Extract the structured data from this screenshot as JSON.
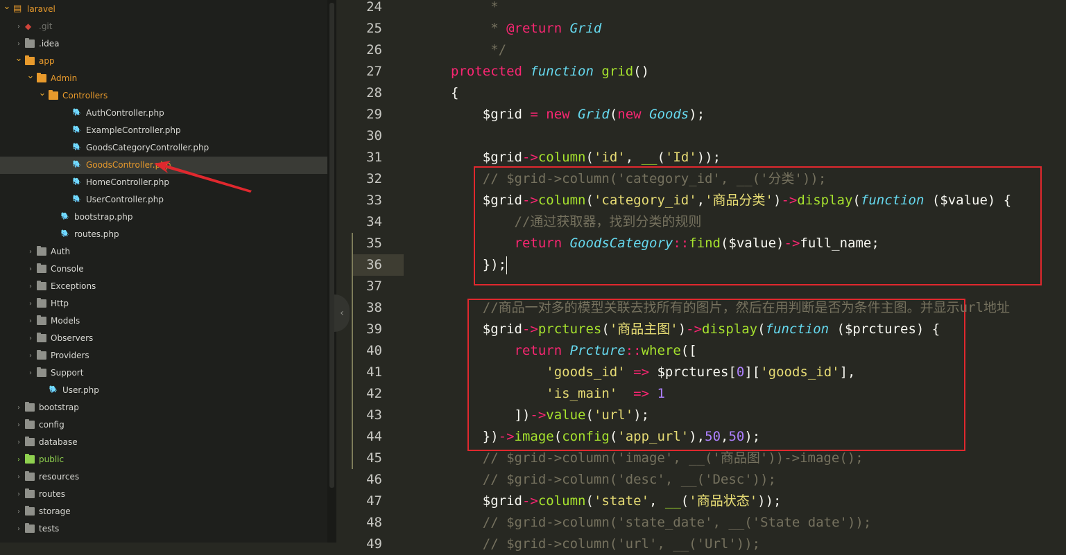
{
  "sidebar": {
    "items": [
      {
        "label": "laravel",
        "kind": "root",
        "arrow": "open",
        "style": "orange"
      },
      {
        "label": ".git",
        "kind": "git",
        "arrow": "closed",
        "style": "dim"
      },
      {
        "label": ".idea",
        "kind": "folder",
        "arrow": "closed",
        "style": ""
      },
      {
        "label": "app",
        "kind": "folder-orange",
        "arrow": "open",
        "style": "orange"
      },
      {
        "label": "Admin",
        "kind": "folder-orange",
        "arrow": "open",
        "style": "orange"
      },
      {
        "label": "Controllers",
        "kind": "folder-orange",
        "arrow": "open",
        "style": "orange"
      },
      {
        "label": "AuthController.php",
        "kind": "php",
        "arrow": "",
        "style": ""
      },
      {
        "label": "ExampleController.php",
        "kind": "php",
        "arrow": "",
        "style": ""
      },
      {
        "label": "GoodsCategoryController.php",
        "kind": "php",
        "arrow": "",
        "style": ""
      },
      {
        "label": "GoodsController.php",
        "kind": "php",
        "arrow": "",
        "style": "orange",
        "selected": true
      },
      {
        "label": "HomeController.php",
        "kind": "php",
        "arrow": "",
        "style": ""
      },
      {
        "label": "UserController.php",
        "kind": "php",
        "arrow": "",
        "style": ""
      },
      {
        "label": "bootstrap.php",
        "kind": "php",
        "arrow": "",
        "style": ""
      },
      {
        "label": "routes.php",
        "kind": "php",
        "arrow": "",
        "style": ""
      },
      {
        "label": "Auth",
        "kind": "folder",
        "arrow": "closed",
        "style": ""
      },
      {
        "label": "Console",
        "kind": "folder",
        "arrow": "closed",
        "style": ""
      },
      {
        "label": "Exceptions",
        "kind": "folder",
        "arrow": "closed",
        "style": ""
      },
      {
        "label": "Http",
        "kind": "folder",
        "arrow": "closed",
        "style": ""
      },
      {
        "label": "Models",
        "kind": "folder",
        "arrow": "closed",
        "style": ""
      },
      {
        "label": "Observers",
        "kind": "folder",
        "arrow": "closed",
        "style": ""
      },
      {
        "label": "Providers",
        "kind": "folder",
        "arrow": "closed",
        "style": ""
      },
      {
        "label": "Support",
        "kind": "folder",
        "arrow": "closed",
        "style": ""
      },
      {
        "label": "User.php",
        "kind": "php",
        "arrow": "",
        "style": ""
      },
      {
        "label": "bootstrap",
        "kind": "folder",
        "arrow": "closed",
        "style": ""
      },
      {
        "label": "config",
        "kind": "folder",
        "arrow": "closed",
        "style": ""
      },
      {
        "label": "database",
        "kind": "folder",
        "arrow": "closed",
        "style": ""
      },
      {
        "label": "public",
        "kind": "folder-green",
        "arrow": "closed-green",
        "style": "green"
      },
      {
        "label": "resources",
        "kind": "folder",
        "arrow": "closed",
        "style": ""
      },
      {
        "label": "routes",
        "kind": "folder",
        "arrow": "closed",
        "style": ""
      },
      {
        "label": "storage",
        "kind": "folder",
        "arrow": "closed",
        "style": ""
      },
      {
        "label": "tests",
        "kind": "folder",
        "arrow": "closed",
        "style": ""
      }
    ]
  },
  "editor": {
    "line_numbers": [
      "24",
      "25",
      "26",
      "27",
      "28",
      "29",
      "30",
      "31",
      "32",
      "33",
      "34",
      "35",
      "36",
      "37",
      "38",
      "39",
      "40",
      "41",
      "42",
      "43",
      "44",
      "45",
      "46",
      "47",
      "48",
      "49"
    ],
    "current_line": "36",
    "lines": [
      [
        {
          "t": "     *",
          "c": "cm"
        }
      ],
      [
        {
          "t": "     * ",
          "c": "cm"
        },
        {
          "t": "@return",
          "c": "kw"
        },
        {
          "t": " ",
          "c": ""
        },
        {
          "t": "Grid",
          "c": "it"
        }
      ],
      [
        {
          "t": "     */",
          "c": "cm"
        }
      ],
      [
        {
          "t": "protected",
          "c": "kw"
        },
        {
          "t": " ",
          "c": ""
        },
        {
          "t": "function",
          "c": "it"
        },
        {
          "t": " ",
          "c": ""
        },
        {
          "t": "grid",
          "c": "fn"
        },
        {
          "t": "()",
          "c": ""
        }
      ],
      [
        {
          "t": "{",
          "c": ""
        }
      ],
      [
        {
          "t": "    $grid ",
          "c": ""
        },
        {
          "t": "=",
          "c": "op"
        },
        {
          "t": " ",
          "c": ""
        },
        {
          "t": "new",
          "c": "kw"
        },
        {
          "t": " ",
          "c": ""
        },
        {
          "t": "Grid",
          "c": "cls"
        },
        {
          "t": "(",
          "c": ""
        },
        {
          "t": "new",
          "c": "kw"
        },
        {
          "t": " ",
          "c": ""
        },
        {
          "t": "Goods",
          "c": "cls"
        },
        {
          "t": ");",
          "c": ""
        }
      ],
      [],
      [
        {
          "t": "    $grid",
          "c": ""
        },
        {
          "t": "->",
          "c": "op"
        },
        {
          "t": "column",
          "c": "fn"
        },
        {
          "t": "(",
          "c": ""
        },
        {
          "t": "'id'",
          "c": "str"
        },
        {
          "t": ", ",
          "c": ""
        },
        {
          "t": "__",
          "c": "fn"
        },
        {
          "t": "(",
          "c": ""
        },
        {
          "t": "'Id'",
          "c": "str"
        },
        {
          "t": "));",
          "c": ""
        }
      ],
      [
        {
          "t": "    // $grid->column('category_id', __('分类'));",
          "c": "cm"
        }
      ],
      [
        {
          "t": "    $grid",
          "c": ""
        },
        {
          "t": "->",
          "c": "op"
        },
        {
          "t": "column",
          "c": "fn"
        },
        {
          "t": "(",
          "c": ""
        },
        {
          "t": "'category_id'",
          "c": "str"
        },
        {
          "t": ",",
          "c": ""
        },
        {
          "t": "'商品分类'",
          "c": "str"
        },
        {
          "t": ")",
          "c": ""
        },
        {
          "t": "->",
          "c": "op"
        },
        {
          "t": "display",
          "c": "fn"
        },
        {
          "t": "(",
          "c": ""
        },
        {
          "t": "function",
          "c": "it"
        },
        {
          "t": " ($value) {",
          "c": ""
        }
      ],
      [
        {
          "t": "        //通过获取器，找到分类的规则",
          "c": "cm"
        }
      ],
      [
        {
          "t": "        ",
          "c": ""
        },
        {
          "t": "return",
          "c": "kw"
        },
        {
          "t": " ",
          "c": ""
        },
        {
          "t": "GoodsCategory",
          "c": "cls"
        },
        {
          "t": "::",
          "c": "op"
        },
        {
          "t": "find",
          "c": "fn"
        },
        {
          "t": "($value)",
          "c": ""
        },
        {
          "t": "->",
          "c": "op"
        },
        {
          "t": "full_name;",
          "c": ""
        }
      ],
      [
        {
          "t": "    });",
          "c": ""
        },
        {
          "t": "",
          "c": "caret"
        }
      ],
      [],
      [
        {
          "t": "    //商品一对多的模型关联去找所有的图片，然后在用判断是否为条件主图。并显示url地址",
          "c": "cm"
        }
      ],
      [
        {
          "t": "    $grid",
          "c": ""
        },
        {
          "t": "->",
          "c": "op"
        },
        {
          "t": "prctures",
          "c": "fn"
        },
        {
          "t": "(",
          "c": ""
        },
        {
          "t": "'商品主图'",
          "c": "str"
        },
        {
          "t": ")",
          "c": ""
        },
        {
          "t": "->",
          "c": "op"
        },
        {
          "t": "display",
          "c": "fn"
        },
        {
          "t": "(",
          "c": ""
        },
        {
          "t": "function",
          "c": "it"
        },
        {
          "t": " ($prctures) {",
          "c": ""
        }
      ],
      [
        {
          "t": "        ",
          "c": ""
        },
        {
          "t": "return",
          "c": "kw"
        },
        {
          "t": " ",
          "c": ""
        },
        {
          "t": "Prcture",
          "c": "cls"
        },
        {
          "t": "::",
          "c": "op"
        },
        {
          "t": "where",
          "c": "fn"
        },
        {
          "t": "([",
          "c": ""
        }
      ],
      [
        {
          "t": "            ",
          "c": ""
        },
        {
          "t": "'goods_id'",
          "c": "str"
        },
        {
          "t": " ",
          "c": ""
        },
        {
          "t": "=>",
          "c": "op"
        },
        {
          "t": " $prctures[",
          "c": ""
        },
        {
          "t": "0",
          "c": "num"
        },
        {
          "t": "][",
          "c": ""
        },
        {
          "t": "'goods_id'",
          "c": "str"
        },
        {
          "t": "],",
          "c": ""
        }
      ],
      [
        {
          "t": "            ",
          "c": ""
        },
        {
          "t": "'is_main'",
          "c": "str"
        },
        {
          "t": "  ",
          "c": ""
        },
        {
          "t": "=>",
          "c": "op"
        },
        {
          "t": " ",
          "c": ""
        },
        {
          "t": "1",
          "c": "num"
        }
      ],
      [
        {
          "t": "        ])",
          "c": ""
        },
        {
          "t": "->",
          "c": "op"
        },
        {
          "t": "value",
          "c": "fn"
        },
        {
          "t": "(",
          "c": ""
        },
        {
          "t": "'url'",
          "c": "str"
        },
        {
          "t": ");",
          "c": ""
        }
      ],
      [
        {
          "t": "    })",
          "c": ""
        },
        {
          "t": "->",
          "c": "op"
        },
        {
          "t": "image",
          "c": "fn"
        },
        {
          "t": "(",
          "c": ""
        },
        {
          "t": "config",
          "c": "fn"
        },
        {
          "t": "(",
          "c": ""
        },
        {
          "t": "'app_url'",
          "c": "str"
        },
        {
          "t": "),",
          "c": ""
        },
        {
          "t": "50",
          "c": "num"
        },
        {
          "t": ",",
          "c": ""
        },
        {
          "t": "50",
          "c": "num"
        },
        {
          "t": ");",
          "c": ""
        }
      ],
      [
        {
          "t": "    // $grid->column('image', __('商品图'))->image();",
          "c": "cm"
        }
      ],
      [
        {
          "t": "    // $grid->column('desc', __('Desc'));",
          "c": "cm"
        }
      ],
      [
        {
          "t": "    $grid",
          "c": ""
        },
        {
          "t": "->",
          "c": "op"
        },
        {
          "t": "column",
          "c": "fn"
        },
        {
          "t": "(",
          "c": ""
        },
        {
          "t": "'state'",
          "c": "str"
        },
        {
          "t": ", ",
          "c": ""
        },
        {
          "t": "__",
          "c": "fn"
        },
        {
          "t": "(",
          "c": ""
        },
        {
          "t": "'商品状态'",
          "c": "str"
        },
        {
          "t": "));",
          "c": ""
        }
      ],
      [
        {
          "t": "    // $grid->column('state_date', __('State date'));",
          "c": "cm"
        }
      ],
      [
        {
          "t": "    // $grid->column('url', __('Url'));",
          "c": "cm"
        }
      ]
    ]
  },
  "icons": {
    "collapse": "chevron-left-icon"
  }
}
